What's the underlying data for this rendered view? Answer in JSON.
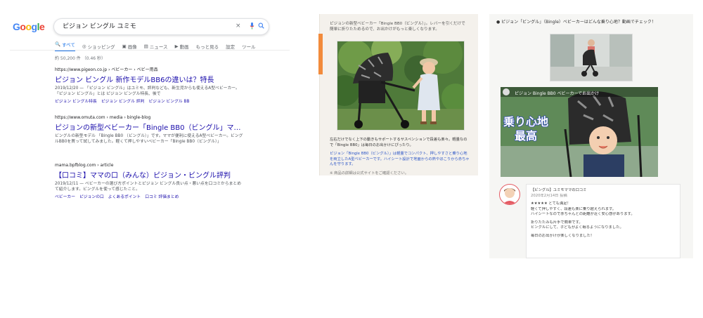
{
  "search": {
    "logo": [
      "G",
      "o",
      "o",
      "g",
      "l",
      "e"
    ],
    "query": "ピジョン ビングル ユミモ",
    "clear_icon": "×",
    "mic_icon": "mic-icon",
    "lens_icon": "search-icon",
    "tabs": [
      {
        "icon": "🔍",
        "label": "すべて",
        "active": true
      },
      {
        "icon": "◎",
        "label": "ショッピング",
        "active": false
      },
      {
        "icon": "▣",
        "label": "画像",
        "active": false
      },
      {
        "icon": "▤",
        "label": "ニュース",
        "active": false
      },
      {
        "icon": "▶",
        "label": "動画",
        "active": false
      },
      {
        "icon": "",
        "label": "もっと見る",
        "active": false
      },
      {
        "icon": "",
        "label": "設定",
        "active": false
      },
      {
        "icon": "",
        "label": "ツール",
        "active": false
      }
    ],
    "stats": "約 50,200 件 （0.46 秒）",
    "results": [
      {
        "url": "https://www.pigeon.co.jp › ベビーカー › ベビー用品",
        "title": "ピジョン ビングル 新作モデルBB6の違いは？特長",
        "snippet": "2019/12/20 — 「ピジョン ビングル」はユミモ、評判なども、新生児からも使えるA型ベビーカー。「ピジョン ビングル」とは ピジョン ビングル特長、後で",
        "links": [
          "ピジョン ビングル特長",
          "ピジョン ビングル 評判",
          "ピジョン ビングル BB"
        ]
      },
      {
        "url": "https://www.omuta.com › media › bingle-blog",
        "title": "ピジョンの新型ベビーカー「Bingle BB0（ビングル」マ…",
        "snippet": "ビングルの新型モデル 「Bingle BB0 （ビングル）」です。ママが便利に使えるA型ベビーカー。ビングルBB0を買って試してみました。軽くて押しやすいベビーカー「Bingle BB0（ビングル）」",
        "links": []
      },
      {
        "url": "mama.bpfblog.com › article",
        "title": "【口コミ】ママの口（みんな）ピジョン・ビングル評判",
        "snippet": "2019/12/11 — ベビーカーの選び方ポイントとピジョン ビングル良い点・悪い点を口コミからまとめて紹介します。ビングルを使って感じたこと。",
        "links": [
          "ベビーカー",
          "ピジョンの口",
          "よくあるポイント",
          "口コミ 評価まとめ"
        ]
      }
    ]
  },
  "article": {
    "caption": "ピジョンの新型ベビーカー「Bingle BB0（ビングル）」。レバーを引くだけで簡単に折りたためるので、お出かけがもっと楽しくなります。",
    "body_title": "左右だけでなく上下の動きもサポートするサスペンションで段差も楽々。軽量なので「Bingle BB0」は毎日のお出かけにぴったり。",
    "body": "ピジョン「Bingle BB0（ビングル）」は軽量でコンパクト、押しやすさと乗り心地を両立したA型ベビーカーです。ハイシート設計で地面からの熱やほこりから赤ちゃんを守ります。",
    "footnote": "※ 商品の詳細は公式サイトをご確認ください。"
  },
  "blog": {
    "header": "● ピジョン「ビングル」（Bingle）ベビーカーはどんな乗り心地？動画でチェック！",
    "video_title": "ピジョン Bingle BB0 ベビーカーでお出かけ",
    "video_caption": [
      "乗り心地",
      "最高"
    ],
    "comment": {
      "name": "【ビングル】ユミモママの口コミ",
      "meta": "2020年2月14日 投稿",
      "lines": [
        "★★★★★ とても満足！",
        "軽くて押しやすく、段差も楽に乗り越えられます。",
        "ハイシートなので赤ちゃんとの距離が近く安心感があります。",
        "折りたたみも片手で簡単です。",
        "ビングルにして、子どもがよく眠るようになりました。",
        "毎日のお出かけが楽しくなりました！"
      ]
    }
  },
  "colors": {
    "link": "#1a0dab",
    "accent_orange": "#f28b3c",
    "caption_stroke": "#1f3fa8"
  }
}
